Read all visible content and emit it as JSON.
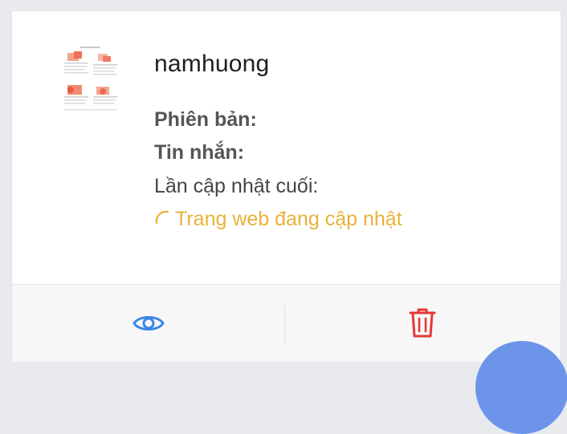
{
  "site": {
    "name": "namhuong",
    "version_label": "Phiên bản:",
    "message_label": "Tin nhắn:",
    "last_updated_label": "Lần cập nhật cuối:",
    "status_text": "Trang web đang cập nhật"
  },
  "icons": {
    "view": "eye-icon",
    "delete": "trash-icon",
    "status": "spinner-icon"
  },
  "colors": {
    "status": "#e8b23a",
    "view": "#3a86e8",
    "delete": "#e53935",
    "fab": "#6c95ea"
  }
}
